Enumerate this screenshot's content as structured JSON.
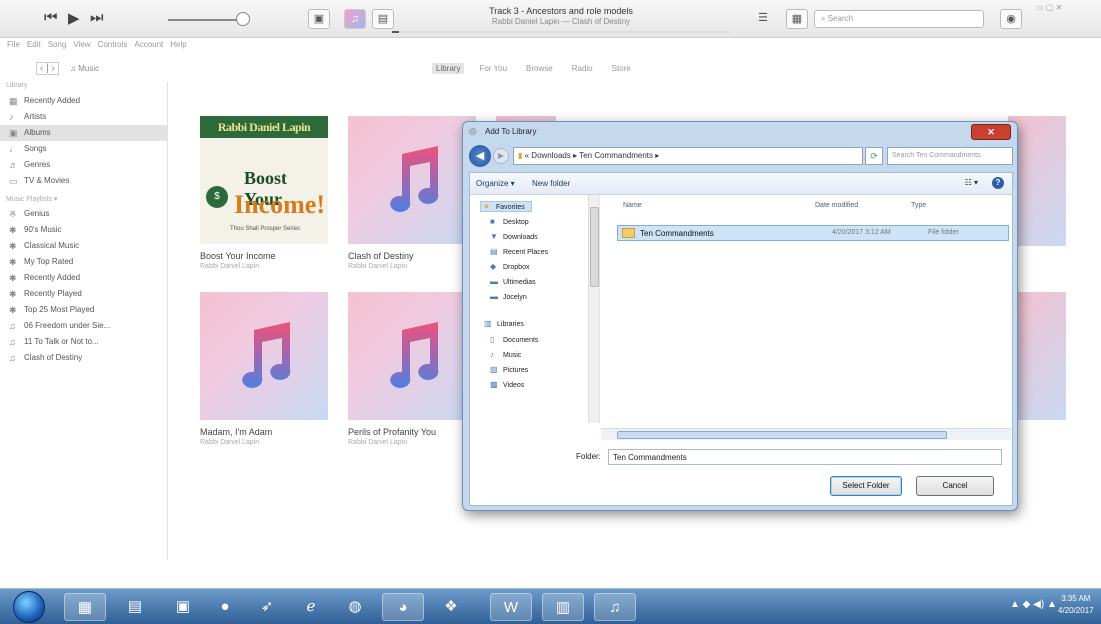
{
  "player": {
    "prev": "⏮",
    "play": "▶",
    "next": "⏭",
    "now_playing_title": "Track 3 - Ancestors and role models",
    "now_playing_sub": "Rabbi Daniel Lapin — Clash of Destiny",
    "search_placeholder": "Search",
    "progress_percent": 2
  },
  "menubar": [
    "File",
    "Edit",
    "Song",
    "View",
    "Controls",
    "Account",
    "Help"
  ],
  "nav": {
    "back_forward": "‹ | ›",
    "library_selector": "♫ Music",
    "tabs": [
      "Library",
      "For You",
      "Browse",
      "Radio",
      "Store"
    ],
    "active_tab": "Library"
  },
  "sidebar": {
    "library_heading": "Library",
    "library_items": [
      {
        "label": "Recently Added",
        "icon": "calendar-icon"
      },
      {
        "label": "Artists",
        "icon": "mic-icon"
      },
      {
        "label": "Albums",
        "icon": "album-icon",
        "selected": true
      },
      {
        "label": "Songs",
        "icon": "note-icon"
      },
      {
        "label": "Genres",
        "icon": "genres-icon"
      },
      {
        "label": "TV & Movies",
        "icon": "tv-icon"
      }
    ],
    "playlists_heading": "Music Playlists ▾",
    "playlist_items": [
      {
        "label": "Genius",
        "icon": "genius-icon"
      },
      {
        "label": "90's Music",
        "icon": "gear-icon"
      },
      {
        "label": "Classical Music",
        "icon": "gear-icon"
      },
      {
        "label": "My Top Rated",
        "icon": "gear-icon"
      },
      {
        "label": "Recently Added",
        "icon": "gear-icon"
      },
      {
        "label": "Recently Played",
        "icon": "gear-icon"
      },
      {
        "label": "Top 25 Most Played",
        "icon": "gear-icon"
      },
      {
        "label": "06 Freedom under Sie...",
        "icon": "playlist-icon"
      },
      {
        "label": "11 To Talk or Not to...",
        "icon": "playlist-icon"
      },
      {
        "label": "Clash of Destiny",
        "icon": "playlist-icon"
      }
    ]
  },
  "albums": [
    {
      "title": "Boost Your Income",
      "artist": "Rabbi Daniel Lapin"
    },
    {
      "title": "Clash of Destiny",
      "artist": "Rabbi Daniel Lapin"
    },
    {
      "title": "Madam, I'm Adam",
      "artist": "Rabbi Daniel Lapin"
    },
    {
      "title": "Perils of Profanity You",
      "artist": "Rabbi Daniel Lapin"
    }
  ],
  "boost_cover": {
    "author": "Rabbi Daniel Lapin",
    "line1": "Boost Your",
    "line2": "Income!",
    "footer": "Thou Shall Prosper Series"
  },
  "dialog": {
    "title": "Add To Library",
    "close_label": "✕",
    "address": "« Downloads ▸ Ten Commandments ▸",
    "search_placeholder": "Search Ten Commandments",
    "organize": "Organize ▾",
    "new_folder": "New folder",
    "nav_items": [
      {
        "label": "Favorites",
        "icon": "star-icon",
        "selected": true
      },
      {
        "label": "Desktop",
        "icon": "desktop-icon"
      },
      {
        "label": "Downloads",
        "icon": "downloads-icon"
      },
      {
        "label": "Recent Places",
        "icon": "recent-icon"
      },
      {
        "label": "Dropbox",
        "icon": "dropbox-icon"
      },
      {
        "label": "Ultimedias",
        "icon": "folder-icon"
      },
      {
        "label": "Jocelyn",
        "icon": "folder-icon"
      },
      {
        "label": "Libraries",
        "icon": "libraries-icon"
      },
      {
        "label": "Documents",
        "icon": "documents-icon"
      },
      {
        "label": "Music",
        "icon": "music-icon"
      },
      {
        "label": "Pictures",
        "icon": "pictures-icon"
      },
      {
        "label": "Videos",
        "icon": "videos-icon"
      }
    ],
    "columns": {
      "name": "Name",
      "date": "Date modified",
      "type": "Type"
    },
    "rows": [
      {
        "name": "Ten Commandments",
        "date": "4/20/2017 3:12 AM",
        "type": "File folder"
      }
    ],
    "folder_label": "Folder:",
    "folder_value": "Ten Commandments",
    "select_button": "Select Folder",
    "cancel_button": "Cancel"
  },
  "taskbar": {
    "time": "3:35 AM",
    "date": "4/20/2017",
    "tray_icons": "▲ ◆ ◀) ▲"
  }
}
